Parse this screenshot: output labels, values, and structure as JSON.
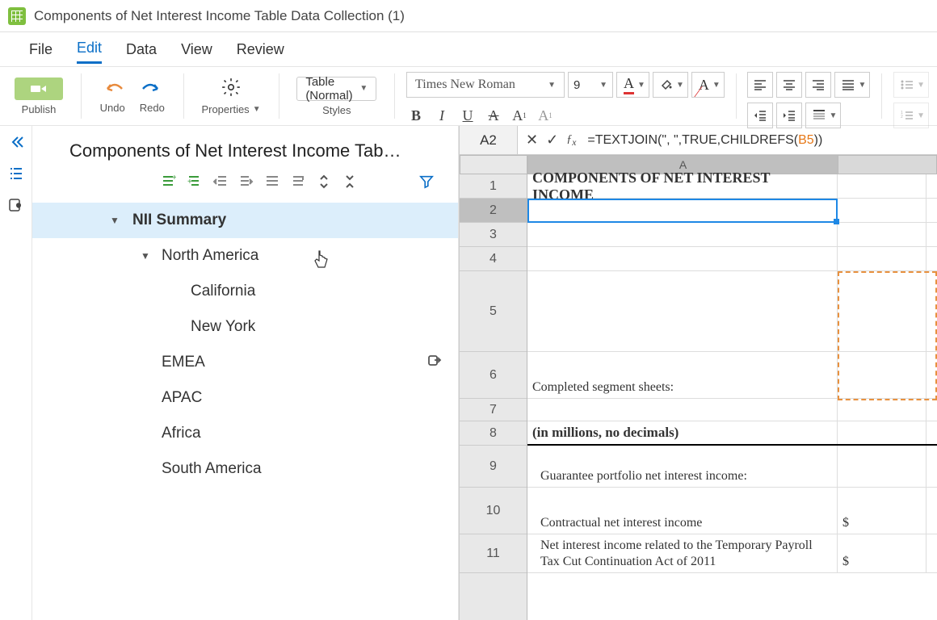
{
  "titlebar": {
    "doc_title": "Components of Net Interest Income Table Data Collection (1)"
  },
  "menubar": {
    "file": "File",
    "edit": "Edit",
    "data": "Data",
    "view": "View",
    "review": "Review",
    "active": "edit"
  },
  "toolbar": {
    "publish": "Publish",
    "undo": "Undo",
    "redo": "Redo",
    "properties": "Properties",
    "styles_label": "Styles",
    "styles_value": "Table (Normal)",
    "font": "Times New Roman",
    "font_size": "9",
    "bold": "B",
    "italic": "I",
    "underline": "U",
    "strike": "A",
    "txtA1": "A",
    "txtA2": "A"
  },
  "sidepanel": {
    "title": "Components of Net Interest Income Tab…",
    "tree": {
      "root": {
        "label": "NII Summary",
        "expanded": true
      },
      "na": {
        "label": "North America",
        "expanded": true
      },
      "ca": {
        "label": "California"
      },
      "ny": {
        "label": "New York"
      },
      "emea": {
        "label": "EMEA"
      },
      "apac": {
        "label": "APAC"
      },
      "africa": {
        "label": "Africa"
      },
      "sa": {
        "label": "South America"
      }
    }
  },
  "fx": {
    "cellref": "A2",
    "formula_pre": "=TEXTJOIN(\", \",TRUE,CHILDREFS(",
    "formula_ref": "B5",
    "formula_post": "))"
  },
  "grid": {
    "colA": "A",
    "rows": {
      "1": "1",
      "2": "2",
      "3": "3",
      "4": "4",
      "5": "5",
      "6": "6",
      "7": "7",
      "8": "8",
      "9": "9",
      "10": "10",
      "11": "11"
    },
    "r1": "COMPONENTS OF NET INTEREST INCOME",
    "r6": "Completed segment sheets:",
    "r8": "(in millions, no decimals)",
    "r9": "Guarantee portfolio net interest income:",
    "r10": "Contractual net interest income",
    "r10b": "$",
    "r11": "Net interest income related to the Temporary Payroll Tax Cut Continuation Act of 2011",
    "r11b": "$"
  }
}
